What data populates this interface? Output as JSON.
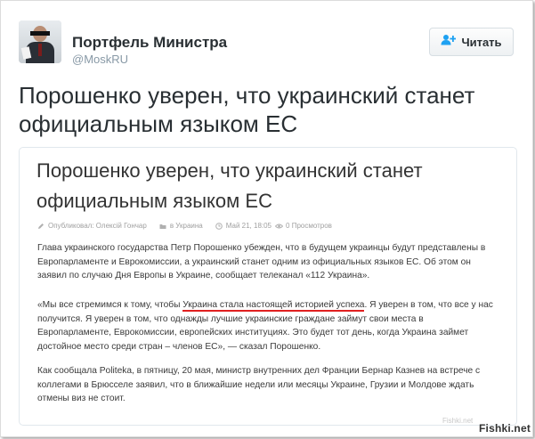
{
  "profile": {
    "name": "Портфель Министра",
    "handle": "@MoskRU"
  },
  "follow_button": {
    "label": "Читать",
    "icon": "add-user-icon"
  },
  "tweet": {
    "text_line1": "Порошенко уверен, что украинский станет",
    "text_line2": "официальным языком ЕС"
  },
  "card": {
    "title_line1": "Порошенко уверен, что украинский станет",
    "title_line2": "официальным языком ЕС",
    "meta": {
      "author": "Опубликовал: Олексій Гончар",
      "category": "в Украина",
      "date": "Май 21, 18:05",
      "views": "0 Просмотров"
    },
    "paragraphs": {
      "p1": "Глава украинского государства Петр Порошенко убежден, что в будущем украинцы будут представлены в Европарламенте и Еврокомиссии, а украинский станет одним из официальных языков ЕС. Об этом он заявил по случаю Дня Европы в Украине, сообщает телеканал «112 Украина».",
      "p2_before": "«Мы все стремимся к тому, чтобы ",
      "p2_highlight": "Украина стала настоящей историей успеха",
      "p2_after": ". Я уверен в том, что все у нас получится. Я уверен в том, что однажды лучшие украинские граждане займут свои места в Европарламенте, Еврокомиссии, европейских институциях. Это будет тот день, когда Украина займет достойное место среди стран – членов ЕС», — сказал Порошенко.",
      "p3": "Как сообщала Politeka, в пятницу, 20 мая, министр внутренних дел Франции Бернар Казнев на встрече с коллегами в Брюсселе заявил, что в ближайшие недели или месяцы Украине, Грузии и Молдове ждать отмены виз не стоит."
    }
  },
  "watermark": {
    "small": "Fishki.net",
    "brand": "Fishki.net"
  },
  "colors": {
    "accent_red": "#e02020",
    "handle_gray": "#8899a6",
    "text": "#292f33"
  }
}
